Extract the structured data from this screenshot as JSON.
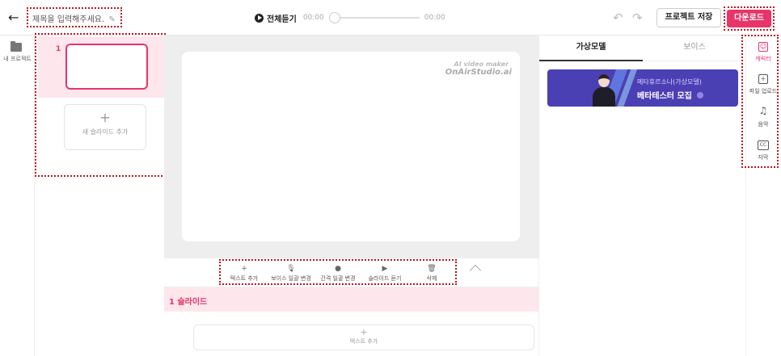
{
  "header": {
    "back_icon": "arrow-left-icon",
    "title_placeholder": "제목을 입력해주세요.",
    "play_all_label": "전체듣기",
    "time_start": "00:00",
    "time_end": "00:00",
    "save_label": "프로젝트 저장",
    "download_label": "다운로드",
    "accent": "#e8346a"
  },
  "left_rail": {
    "my_projects_label": "내 프로젝트"
  },
  "slides": {
    "items": [
      {
        "number": "1"
      }
    ],
    "add_label": "새 슬라이드 추가"
  },
  "canvas": {
    "watermark_line1": "AI video maker",
    "watermark_line2": "OnAirStudio.ai"
  },
  "toolbar": {
    "add_text": "텍스트 추가",
    "voice_change": "보이스 일괄 변경",
    "gap_change": "간격 일괄 변경",
    "listen_slide": "슬라이드 듣기",
    "delete": "삭제"
  },
  "slide_section": {
    "header": "1 슬라이드",
    "add_text_label": "텍스트 추가"
  },
  "right_panel": {
    "tabs": [
      {
        "label": "가상모델",
        "active": true
      },
      {
        "label": "보이스",
        "active": false
      }
    ],
    "banner_line1": "메타휴르소나(가상모델)",
    "banner_line2": "베타테스터 모집"
  },
  "right_sidebar": {
    "items": [
      {
        "label": "캐릭터",
        "icon": "character-icon",
        "active": true
      },
      {
        "label": "파일 업로드",
        "icon": "file-upload-icon",
        "active": false
      },
      {
        "label": "음악",
        "icon": "music-icon",
        "active": false
      },
      {
        "label": "자막",
        "icon": "caption-icon",
        "active": false
      }
    ]
  }
}
